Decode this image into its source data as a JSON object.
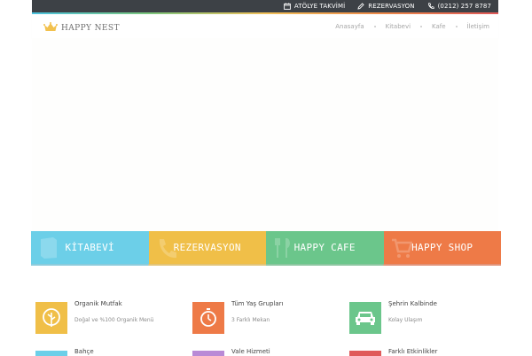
{
  "topbar": {
    "links": [
      {
        "label": "ATÖLYE TAKVİMİ",
        "icon": "calendar-icon"
      },
      {
        "label": "REZERVASYON",
        "icon": "pencil-icon"
      },
      {
        "label": "(0212) 257 8787",
        "icon": "phone-icon"
      }
    ]
  },
  "brand": {
    "name": "HAPPY NEST",
    "icon": "crown-icon",
    "crown_color": "#f2c14e"
  },
  "nav": {
    "items": [
      "Anasayfa",
      "Kitabevi",
      "Kafe",
      "İletişim"
    ]
  },
  "categories": [
    {
      "label": "KİTABEVİ",
      "color": "#6ccfe8",
      "icon": "book-icon"
    },
    {
      "label": "REZERVASYON",
      "color": "#f0bf48",
      "icon": "phone-icon"
    },
    {
      "label": "HAPPY CAFE",
      "color": "#6bc68b",
      "icon": "cutlery-icon"
    },
    {
      "label": "HAPPY SHOP",
      "color": "#ee7a47",
      "icon": "cart-icon"
    }
  ],
  "features": [
    {
      "title": "Organik Mutfak",
      "subtitle": "Doğal ve %100 Organik Menü",
      "color": "#f0bf48",
      "icon": "leaf-icon"
    },
    {
      "title": "Tüm Yaş Grupları",
      "subtitle": "3 Farklı Mekan",
      "color": "#ee7a47",
      "icon": "stopwatch-icon"
    },
    {
      "title": "Şehrin Kalbinde",
      "subtitle": "Kolay Ulaşım",
      "color": "#6bc68b",
      "icon": "car-icon"
    },
    {
      "title": "Bahçe",
      "color": "#6ccfe8",
      "icon": "tree-icon"
    },
    {
      "title": "Vale Hizmeti",
      "color": "#b98ad6",
      "icon": "key-icon"
    },
    {
      "title": "Farklı Etkinlikler",
      "color": "#e05a5a",
      "icon": "star-icon"
    }
  ]
}
